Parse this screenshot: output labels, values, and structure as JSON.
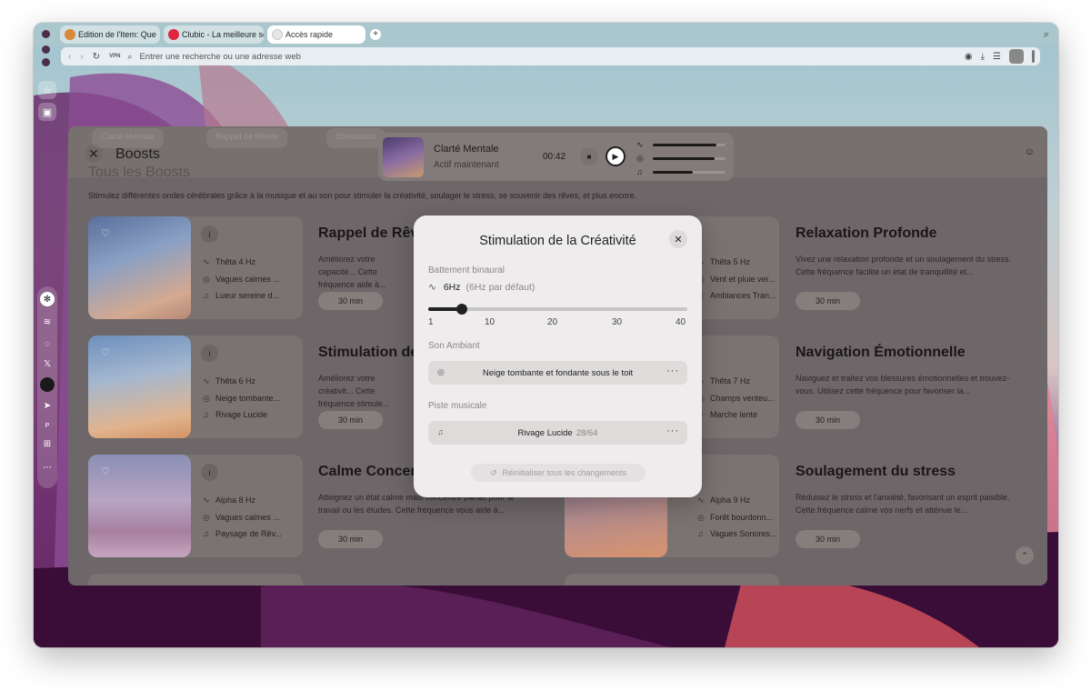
{
  "browser": {
    "tabs": [
      {
        "label": "Edition de l'Item: Que",
        "active": false
      },
      {
        "label": "Clubic - La meilleure so",
        "active": false
      },
      {
        "label": "Accès rapide",
        "active": true
      }
    ],
    "new_tab": "+",
    "address_placeholder": "Entrer une recherche ou une adresse web",
    "vpn_label": "VPN"
  },
  "panel": {
    "title": "Boosts",
    "ghost_chips": [
      "Clarté Mentale",
      "Rappel de Rêves",
      "Stimulation"
    ],
    "section_title": "Tous les Boosts",
    "description": "Stimulez différentes ondes cérébrales grâce à la musique et au son pour stimuler la créativité, soulager le stress, se souvenir des rêves, et plus encore."
  },
  "player": {
    "title": "Clarté Mentale",
    "subtitle": "Actif maintenant",
    "time": "00:42",
    "levels": [
      0.88,
      0.85,
      0.55
    ]
  },
  "cards_left": [
    {
      "freq": "Thêta 4 Hz",
      "ambient": "Vagues calmes ...",
      "music": "Lueur sereine d...",
      "title": "Rappel de Rêv",
      "desc": "Améliorez votre capacité... Cette fréquence aide à...",
      "duration": "30 min"
    },
    {
      "freq": "Thêta 6 Hz",
      "ambient": "Neige tombante...",
      "music": "Rivage Lucide",
      "title": "Stimulation de",
      "desc": "Améliorez votre créativit... Cette fréquence stimule...",
      "duration": "30 min"
    },
    {
      "freq": "Alpha 8 Hz",
      "ambient": "Vagues calmes ...",
      "music": "Paysage de Rêv...",
      "title": "Calme Concen",
      "desc": "Atteignez un état calme mais concentré parfait pour le travail ou les études. Cette fréquence vous aide à...",
      "duration": "30 min"
    }
  ],
  "cards_right": [
    {
      "freq": "Thêta 5 Hz",
      "ambient": "Vent et pluie ver...",
      "music": "Ambiances Tran...",
      "title": "Relaxation Profonde",
      "desc": "Vivez une relaxation profonde et un soulagement du stress. Cette fréquence facilite un état de tranquillité et...",
      "duration": "30 min"
    },
    {
      "freq": "Thêta 7 Hz",
      "ambient": "Champs venteu...",
      "music": "Marche lente",
      "title": "Navigation Émotionnelle",
      "desc": "Naviguez et traitez vos blessures émotionnelles et trouvez-vous. Utilisez cette fréquence pour favoriser la...",
      "duration": "30 min"
    },
    {
      "freq": "Alpha 9 Hz",
      "ambient": "Forêt bourdonn...",
      "music": "Vagues Sonores...",
      "title": "Soulagement du stress",
      "desc": "Réduisez le stress et l'anxiété, favorisant un esprit paisible. Cette fréquence calme vos nerfs et atténue le...",
      "duration": "30 min"
    }
  ],
  "modal": {
    "title": "Stimulation de la Créativité",
    "binaural_label": "Battement binaural",
    "hz_value": "6Hz",
    "hz_default": "(6Hz par défaut)",
    "slider": {
      "min": 1,
      "max": 40,
      "value": 6,
      "ticks": [
        "1",
        "10",
        "20",
        "30",
        "40"
      ]
    },
    "ambient_label": "Son Ambiant",
    "ambient_value": "Neige tombante et fondante sous le toit",
    "music_label": "Piste musicale",
    "music_value": "Rivage Lucide",
    "music_count": "28/64",
    "reset_label": "Réinitialiser tous les changements"
  },
  "colors": {
    "accent": "#222222",
    "panel_bg": "#6e6769",
    "modal_bg": "#eeecec"
  }
}
